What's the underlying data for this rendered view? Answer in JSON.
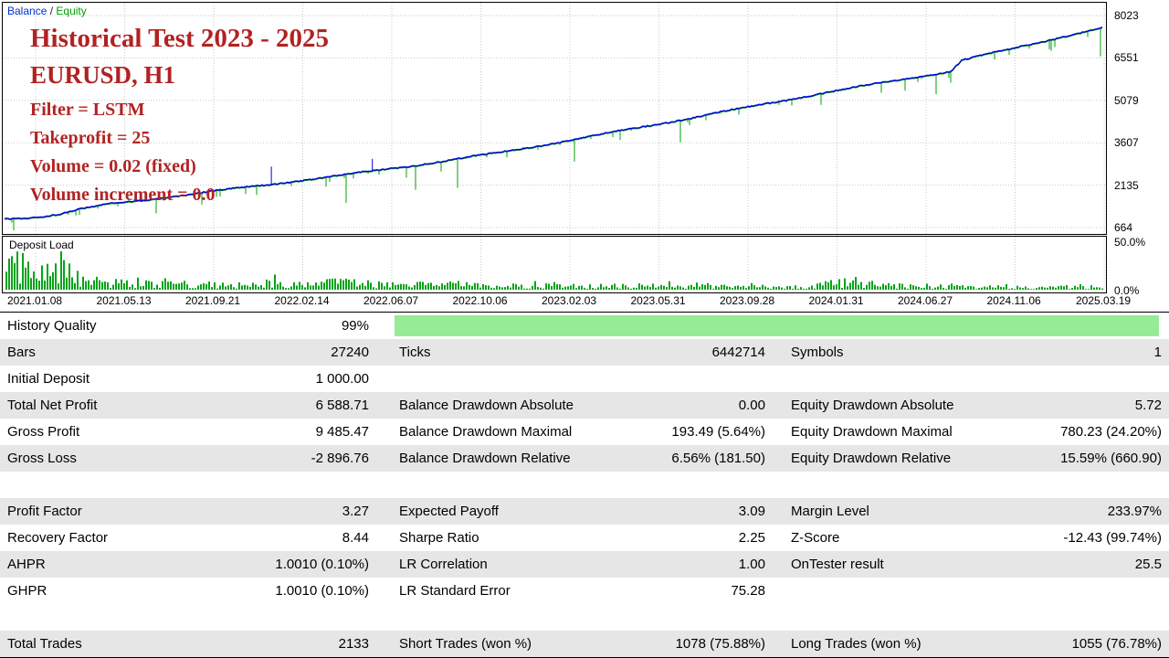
{
  "legend": {
    "balance": "Balance",
    "separator": " / ",
    "equity": "Equity"
  },
  "annotations": {
    "title": "Historical Test 2023 - 2025",
    "symbol": "EURUSD, H1",
    "lines": [
      "Filter = LSTM",
      "Takeprofit = 25",
      "Volume = 0.02 (fixed)",
      "Volume increment = 0.0"
    ]
  },
  "colors": {
    "balance": "#0000dd",
    "equity": "#00a000",
    "deposit_bar": "#00a414",
    "annotation": "#b22222",
    "grid": "#c9c9c9",
    "row_alt": "#e6e6e6",
    "history_bar": "#96ec96"
  },
  "chart_data": {
    "type": "line",
    "title": "Balance / Equity backtest curve",
    "legend_entries": [
      "Balance",
      "Equity"
    ],
    "ylim": [
      664,
      8023
    ],
    "y_ticks": [
      8023,
      6551,
      5079,
      3607,
      2135,
      664
    ],
    "x_ticks": [
      "2021.01.08",
      "2021.05.13",
      "2021.09.21",
      "2022.02.14",
      "2022.06.07",
      "2022.10.06",
      "2023.02.03",
      "2023.05.31",
      "2023.09.28",
      "2024.01.31",
      "2024.06.27",
      "2024.11.06",
      "2025.03.19"
    ],
    "series": [
      {
        "name": "Balance",
        "color": "#0000dd",
        "anchors": [
          [
            0,
            1000
          ],
          [
            0.03,
            1060
          ],
          [
            0.05,
            1150
          ],
          [
            0.07,
            1320
          ],
          [
            0.1,
            1500
          ],
          [
            0.13,
            1620
          ],
          [
            0.17,
            1800
          ],
          [
            0.21,
            1990
          ],
          [
            0.25,
            2180
          ],
          [
            0.3,
            2440
          ],
          [
            0.35,
            2720
          ],
          [
            0.4,
            3000
          ],
          [
            0.45,
            3300
          ],
          [
            0.5,
            3620
          ],
          [
            0.55,
            3950
          ],
          [
            0.6,
            4280
          ],
          [
            0.65,
            4620
          ],
          [
            0.7,
            4980
          ],
          [
            0.75,
            5350
          ],
          [
            0.8,
            5700
          ],
          [
            0.84,
            5980
          ],
          [
            0.862,
            6120
          ],
          [
            0.872,
            6500
          ],
          [
            0.9,
            6750
          ],
          [
            0.95,
            7200
          ],
          [
            1.0,
            7620
          ]
        ]
      },
      {
        "name": "Equity",
        "color": "#00a000",
        "note": "tracks balance with downward drawdown spikes"
      }
    ],
    "up_spikes": [
      {
        "f": 0.243,
        "h": 20
      },
      {
        "f": 0.335,
        "h": 13
      }
    ],
    "deposit_load": {
      "label": "Deposit Load",
      "max_label": "50.0%",
      "min_label": "0.0%",
      "range": [
        0,
        50
      ],
      "envelope": [
        [
          0,
          30
        ],
        [
          0.01,
          44
        ],
        [
          0.02,
          38
        ],
        [
          0.035,
          26
        ],
        [
          0.045,
          48
        ],
        [
          0.055,
          32
        ],
        [
          0.07,
          18
        ],
        [
          0.09,
          13
        ],
        [
          0.12,
          11
        ],
        [
          0.15,
          14
        ],
        [
          0.18,
          9
        ],
        [
          0.21,
          8
        ],
        [
          0.24,
          15
        ],
        [
          0.27,
          8
        ],
        [
          0.3,
          13
        ],
        [
          0.33,
          10
        ],
        [
          0.36,
          7
        ],
        [
          0.4,
          11
        ],
        [
          0.44,
          6
        ],
        [
          0.48,
          8
        ],
        [
          0.52,
          6
        ],
        [
          0.56,
          7
        ],
        [
          0.6,
          8
        ],
        [
          0.64,
          6
        ],
        [
          0.68,
          6
        ],
        [
          0.72,
          7
        ],
        [
          0.75,
          8
        ],
        [
          0.77,
          16
        ],
        [
          0.79,
          10
        ],
        [
          0.82,
          7
        ],
        [
          0.85,
          6
        ],
        [
          0.88,
          5
        ],
        [
          0.91,
          6
        ],
        [
          0.94,
          5
        ],
        [
          0.97,
          5
        ],
        [
          1.0,
          5
        ]
      ]
    }
  },
  "table": {
    "history_quality_pct": 99,
    "alt_rows": [
      false,
      true,
      false,
      true,
      false,
      true,
      false,
      true,
      false,
      true,
      false,
      false,
      true
    ],
    "rows": [
      [
        "History Quality",
        "99%",
        "",
        "",
        "",
        ""
      ],
      [
        "Bars",
        "27240",
        "Ticks",
        "6442714",
        "Symbols",
        "1"
      ],
      [
        "Initial Deposit",
        "1 000.00",
        "",
        "",
        "",
        ""
      ],
      [
        "Total Net Profit",
        "6 588.71",
        "Balance Drawdown Absolute",
        "0.00",
        "Equity Drawdown Absolute",
        "5.72"
      ],
      [
        "Gross Profit",
        "9 485.47",
        "Balance Drawdown Maximal",
        "193.49 (5.64%)",
        "Equity Drawdown Maximal",
        "780.23 (24.20%)"
      ],
      [
        "Gross Loss",
        "-2 896.76",
        "Balance Drawdown Relative",
        "6.56% (181.50)",
        "Equity Drawdown Relative",
        "15.59% (660.90)"
      ],
      [
        "",
        "",
        "",
        "",
        "",
        ""
      ],
      [
        "Profit Factor",
        "3.27",
        "Expected Payoff",
        "3.09",
        "Margin Level",
        "233.97%"
      ],
      [
        "Recovery Factor",
        "8.44",
        "Sharpe Ratio",
        "2.25",
        "Z-Score",
        "-12.43 (99.74%)"
      ],
      [
        "AHPR",
        "1.0010 (0.10%)",
        "LR Correlation",
        "1.00",
        "OnTester result",
        "25.5"
      ],
      [
        "GHPR",
        "1.0010 (0.10%)",
        "LR Standard Error",
        "75.28",
        "",
        ""
      ],
      [
        "",
        "",
        "",
        "",
        "",
        ""
      ],
      [
        "Total Trades",
        "2133",
        "Short Trades (won %)",
        "1078 (75.88%)",
        "Long Trades (won %)",
        "1055 (76.78%)"
      ]
    ]
  }
}
